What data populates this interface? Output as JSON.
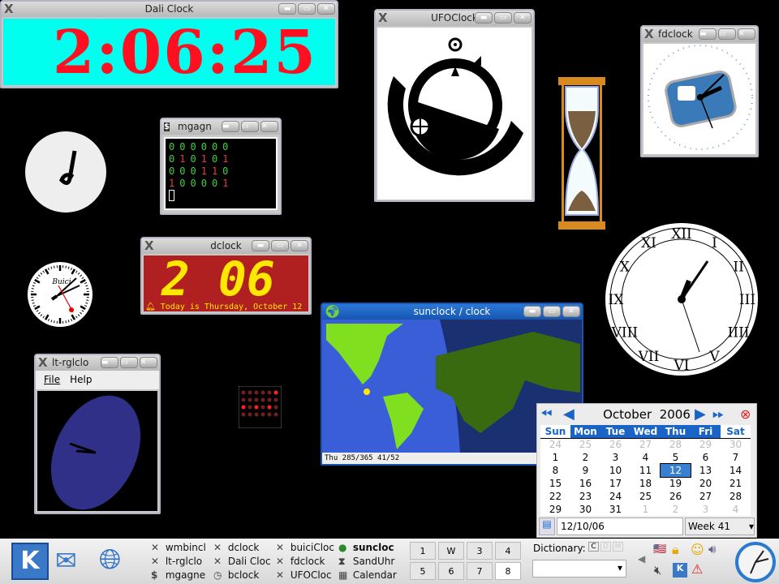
{
  "dali": {
    "title": "Dali Clock",
    "time": "2:06:25"
  },
  "mgagnon": {
    "title": "mgagn",
    "rows": [
      [
        "0",
        "0",
        "0",
        "0",
        "0",
        "0"
      ],
      [
        "0",
        "1",
        "0",
        "1",
        "0",
        "1"
      ],
      [
        "0",
        "0",
        "0",
        "1",
        "1",
        "0"
      ],
      [
        "1",
        "0",
        "0",
        "0",
        "0",
        "1"
      ]
    ]
  },
  "ufo": {
    "title": "UFOClock"
  },
  "fdclock": {
    "title": "fdclock"
  },
  "dclock": {
    "title": "dclock",
    "digits": "2 06",
    "message": "Today is Thursday, October 12"
  },
  "buici": {
    "brand": "Buici"
  },
  "sunclock": {
    "title": "sunclock / clock",
    "status": "Thu 285/365 41/52"
  },
  "rgl": {
    "title": "lt-rglclo",
    "menu": [
      "File",
      "Help"
    ]
  },
  "calendar": {
    "month": "October",
    "year": "2006",
    "days": [
      "Sun",
      "Mon",
      "Tue",
      "Wed",
      "Thu",
      "Fri",
      "Sat"
    ],
    "weeks": [
      [
        "24",
        "25",
        "26",
        "27",
        "28",
        "29",
        "30"
      ],
      [
        "1",
        "2",
        "3",
        "4",
        "5",
        "6",
        "7"
      ],
      [
        "8",
        "9",
        "10",
        "11",
        "12",
        "13",
        "14"
      ],
      [
        "15",
        "16",
        "17",
        "18",
        "19",
        "20",
        "21"
      ],
      [
        "22",
        "23",
        "24",
        "25",
        "26",
        "27",
        "28"
      ],
      [
        "29",
        "30",
        "31",
        "1",
        "2",
        "3",
        "4"
      ]
    ],
    "selected": "12",
    "date_field": "12/10/06",
    "week": "Week 41"
  },
  "taskbar": {
    "tasks": [
      "wmbincl",
      "lt-rglclo",
      "mgagne",
      "dclock",
      "Dali Cloc",
      "bclock",
      "buiciCloc",
      "fdclock",
      "UFOCloc",
      "suncloc",
      "SandUhr",
      "Calendar"
    ],
    "pager": [
      "1",
      "W",
      "3",
      "4",
      "5",
      "6",
      "7",
      "8"
    ],
    "dictionary_label": "Dictionary:",
    "dict_buttons": [
      "C",
      "D",
      "M"
    ],
    "dict_value": ""
  },
  "colors": {
    "accent": "#1a64c8",
    "dali_bg": "#00ffee",
    "dali_fg": "#ff1020",
    "dclock_bg": "#b02020",
    "dclock_fg": "#ffe800"
  }
}
